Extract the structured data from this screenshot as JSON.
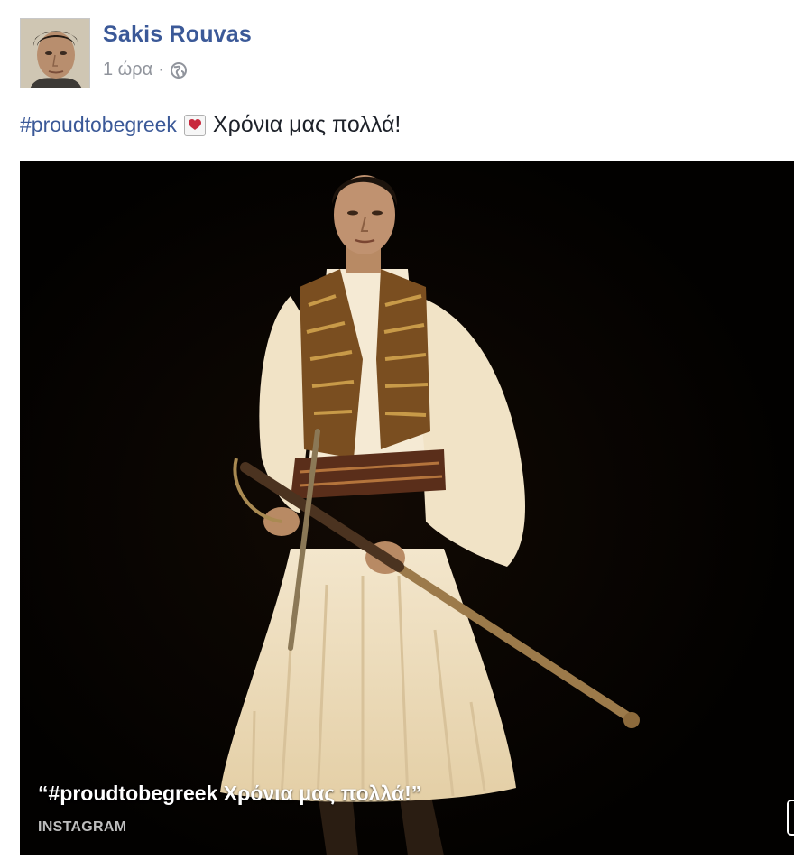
{
  "post": {
    "author_name": "Sakis Rouvas",
    "timestamp": "1 ώρα",
    "separator": "·",
    "privacy_icon": "globe-icon",
    "hashtag": "#proudtobegreek",
    "emoji_icon": "heart-icon",
    "message": "Χρόνια μας πολλά!",
    "attachment": {
      "caption": "“#proudtobegreek Χρόνια μας πολλά!”",
      "source": "INSTAGRAM"
    }
  }
}
